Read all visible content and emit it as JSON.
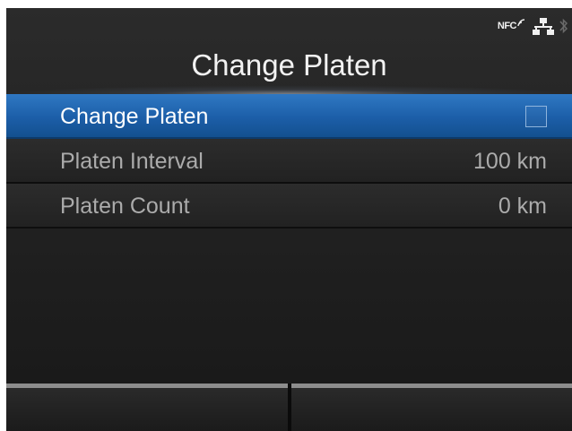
{
  "status": {
    "nfc_label": "NFC",
    "icons": [
      "nfc-icon",
      "network-icon",
      "bluetooth-icon"
    ]
  },
  "header": {
    "title": "Change Platen"
  },
  "menu": {
    "items": [
      {
        "label": "Change Platen",
        "type": "checkbox",
        "checked": false,
        "selected": true
      },
      {
        "label": "Platen Interval",
        "value": "100 km",
        "selected": false
      },
      {
        "label": "Platen Count",
        "value": "0 km",
        "selected": false
      }
    ]
  },
  "softkeys": {
    "left_label": "",
    "right_label": ""
  },
  "colors": {
    "selection": "#1c5ea8",
    "background": "#222222",
    "text_primary": "#ffffff",
    "text_secondary": "#ababab"
  }
}
